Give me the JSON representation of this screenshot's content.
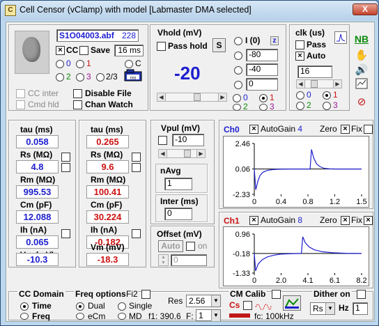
{
  "window": {
    "title": "Cell Censor (vClamp) with model [Labmaster DMA selected]",
    "close_glyph": "X",
    "app_glyph": "C"
  },
  "file": {
    "name": "S1O04003.abf",
    "number": "228",
    "cc_label": "CC",
    "save_label": "Save",
    "duration": "16 ms",
    "radio_0": "0",
    "radio_1": "1",
    "radio_2": "2",
    "radio_3": "3",
    "radio_23": "2/3",
    "radio_c": "C",
    "rxo_label": "rxo"
  },
  "opts": {
    "cc_inter": "CC inter",
    "cmd_hld": "Cmd hld",
    "disable_file": "Disable File",
    "chan_watch": "Chan Watch"
  },
  "vhold": {
    "title": "Vhold (mV)",
    "pass_hold": "Pass hold",
    "s_button": "S",
    "value": "-20",
    "i0_label": "I (0)",
    "z_label": "z",
    "rows": [
      "-80",
      "-40",
      "0"
    ],
    "r0": "0",
    "r1": "1",
    "r2": "2",
    "r3": "3"
  },
  "clk": {
    "title": "clk (us)",
    "pass": "Pass",
    "auto": "Auto",
    "value": "16",
    "r0": "0",
    "r1": "1",
    "r2": "2",
    "r3": "3"
  },
  "toolbar": {
    "nb": "NB"
  },
  "cell1": {
    "tau_label": "tau (ms)",
    "tau": "0.058",
    "rs_label": "Rs (MΩ)",
    "rs": "4.8",
    "rm_label": "Rm (MΩ)",
    "rm": "995.53",
    "cm_label": "Cm (pF)",
    "cm": "12.088",
    "ih_label": "Ih (nA)",
    "ih": "0.065",
    "vm_label": "Vm (mV)",
    "vm": "-10.3"
  },
  "cell2": {
    "tau_label": "tau (ms)",
    "tau": "0.265",
    "rs_label": "Rs (MΩ)",
    "rs": "9.6",
    "rm_label": "Rm (MΩ)",
    "rm": "100.41",
    "cm_label": "Cm (pF)",
    "cm": "30.224",
    "ih_label": "Ih (nA)",
    "ih": "-0.182",
    "vm_label": "Vm (mV)",
    "vm": "-18.3"
  },
  "vpul": {
    "title": "Vpul (mV)",
    "value": "-10",
    "navg_label": "nAvg",
    "navg": "1",
    "inter_label": "Inter (ms)",
    "inter": "0"
  },
  "offset": {
    "title": "Offset (mV)",
    "auto": "Auto",
    "on": "on",
    "value": "0"
  },
  "ch0": {
    "name": "Ch0",
    "autogain": "AutoGain",
    "gain": "4",
    "zero": "Zero",
    "fix": "Fix"
  },
  "ch1": {
    "name": "Ch1",
    "autogain": "AutoGain",
    "gain": "8",
    "zero": "Zero",
    "fix": "Fix"
  },
  "chart_data": [
    {
      "type": "line",
      "yticks": [
        "2.46",
        "0.06",
        "-2.33"
      ],
      "xticks": [
        "0",
        "0.4",
        "0.8",
        "1.2",
        "1.5"
      ],
      "ylim": [
        -2.33,
        2.46
      ],
      "xlim": [
        0,
        1.5
      ],
      "series": [
        {
          "color": "#1d1ecf",
          "x": [
            0,
            0.02,
            0.05,
            0.08,
            0.12,
            0.18,
            0.25,
            0.35,
            0.5,
            0.65,
            0.75,
            0.78
          ],
          "y": [
            0.06,
            -1.9,
            -1.1,
            -0.55,
            -0.25,
            -0.08,
            0.0,
            0.04,
            0.06,
            0.06,
            0.06,
            0.06
          ]
        },
        {
          "color": "#1d1ecf",
          "x": [
            0.78,
            0.8,
            0.83,
            0.87,
            0.92,
            0.98,
            1.05,
            1.15,
            1.3,
            1.5
          ],
          "y": [
            0.06,
            1.9,
            1.1,
            0.55,
            0.27,
            0.12,
            0.07,
            0.06,
            0.06,
            0.06
          ]
        }
      ]
    },
    {
      "type": "line",
      "yticks": [
        "0.96",
        "-0.18",
        "-1.33"
      ],
      "xticks": [
        "0",
        "2.0",
        "4.1",
        "6.1",
        "8.2"
      ],
      "ylim": [
        -1.33,
        0.96
      ],
      "xlim": [
        0,
        8.2
      ],
      "series": [
        {
          "color": "#1d1ecf",
          "x": [
            0,
            0.1,
            0.3,
            0.6,
            1.0,
            1.5,
            2.0,
            2.5,
            3.0,
            3.4,
            3.6
          ],
          "y": [
            -0.18,
            -1.2,
            -0.8,
            -0.55,
            -0.38,
            -0.28,
            -0.22,
            -0.2,
            -0.19,
            -0.18,
            -0.18
          ]
        },
        {
          "color": "#1d1ecf",
          "x": [
            3.6,
            3.7,
            3.9,
            4.2,
            4.6,
            5.2,
            6.0,
            7.0,
            8.2
          ],
          "y": [
            -0.18,
            0.8,
            0.45,
            0.2,
            0.03,
            -0.08,
            -0.14,
            -0.17,
            -0.18
          ]
        }
      ]
    }
  ],
  "bottom": {
    "cc_domain": "CC Domain",
    "time": "Time",
    "freq": "Freq",
    "freq_options": "Freq options",
    "fi2": "Fi2",
    "dual": "Dual",
    "single": "Single",
    "ecm": "eCm",
    "md": "MD",
    "f1": "f1: 390.6",
    "f_label": "F:",
    "f_value": "1",
    "res_label": "Res",
    "res_value": "2.56",
    "cm_calib": "CM Calib",
    "cs": "Cs",
    "fc": "fc: 100kHz",
    "dither": "Dither on",
    "rs_select": "Rs",
    "hz": "Hz",
    "hz_value": "1"
  }
}
